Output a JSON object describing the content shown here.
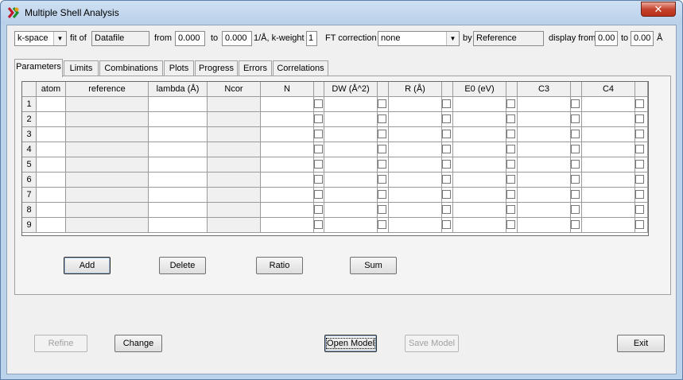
{
  "window": {
    "title": "Multiple Shell Analysis",
    "close_label": "✕"
  },
  "toolbar": {
    "space_combo": "k-space",
    "fit_of_label": "fit of",
    "datafile_value": "Datafile",
    "from_label": "from",
    "from_value": "0.000",
    "to_label": "to",
    "to_value": "0.000",
    "units_label": "1/Å, k-weight",
    "kweight_value": "1",
    "ft_label": "FT correction",
    "ft_combo": "none",
    "by_label": "by",
    "by_value": "Reference",
    "display_from_label": "display from",
    "display_from_value": "0.00",
    "display_to_label": "to",
    "display_to_value": "0.00",
    "display_unit": "Å"
  },
  "tabs": [
    "Parameters",
    "Limits",
    "Combinations",
    "Plots",
    "Progress",
    "Errors",
    "Correlations"
  ],
  "active_tab": "Parameters",
  "grid": {
    "columns": [
      "atom",
      "reference",
      "lambda (Å)",
      "Ncor",
      "N",
      "DW (Å^2)",
      "R (Å)",
      "E0 (eV)",
      "C3",
      "C4"
    ],
    "rows": [
      "1",
      "2",
      "3",
      "4",
      "5",
      "6",
      "7",
      "8",
      "9"
    ]
  },
  "panel_buttons": {
    "add": "Add",
    "delete": "Delete",
    "ratio": "Ratio",
    "sum": "Sum"
  },
  "footer_buttons": {
    "refine": "Refine",
    "change": "Change",
    "open_model": "Open Model",
    "save_model": "Save Model",
    "exit": "Exit"
  }
}
